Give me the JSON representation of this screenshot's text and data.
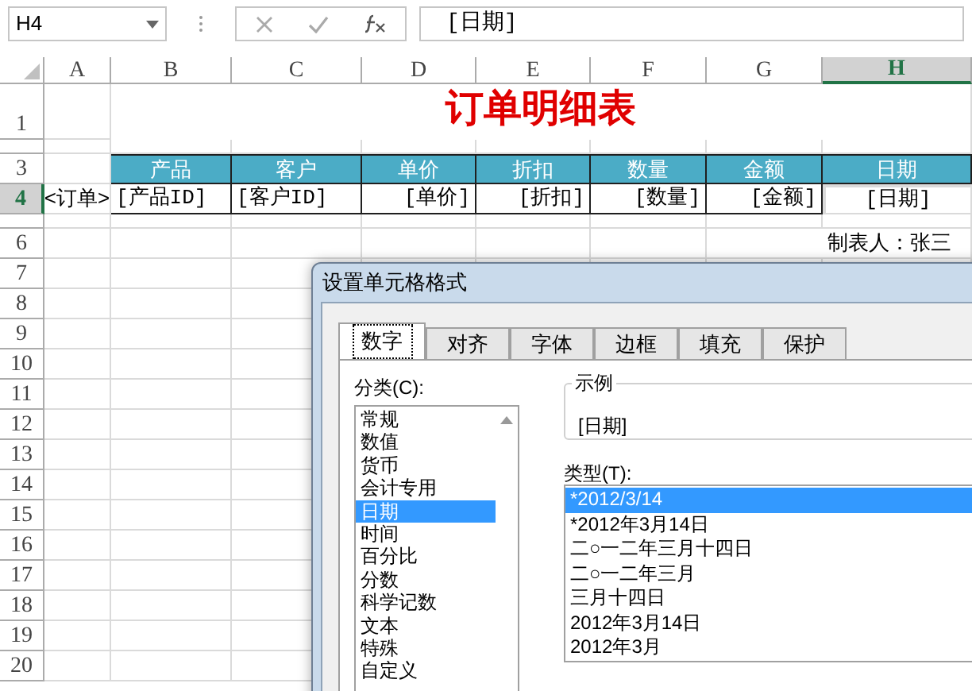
{
  "formula_bar": {
    "name_box": "H4",
    "formula": "[日期]"
  },
  "columns": [
    {
      "label": "A",
      "selected": false
    },
    {
      "label": "B",
      "selected": false
    },
    {
      "label": "C",
      "selected": false
    },
    {
      "label": "D",
      "selected": false
    },
    {
      "label": "E",
      "selected": false
    },
    {
      "label": "F",
      "selected": false
    },
    {
      "label": "G",
      "selected": false
    },
    {
      "label": "H",
      "selected": true
    }
  ],
  "rows": [
    {
      "kind": "title",
      "label": "1",
      "selected": false
    },
    {
      "kind": "short"
    },
    {
      "kind": "normal",
      "label": "3",
      "selected": false
    },
    {
      "kind": "normal",
      "label": "4",
      "selected": true
    },
    {
      "kind": "short"
    },
    {
      "kind": "normal",
      "label": "6",
      "selected": false
    },
    {
      "kind": "normal",
      "label": "7",
      "selected": false
    },
    {
      "kind": "normal",
      "label": "8",
      "selected": false
    },
    {
      "kind": "normal",
      "label": "9",
      "selected": false
    },
    {
      "kind": "normal",
      "label": "10",
      "selected": false
    },
    {
      "kind": "normal",
      "label": "11",
      "selected": false
    },
    {
      "kind": "normal",
      "label": "12",
      "selected": false
    },
    {
      "kind": "normal",
      "label": "13",
      "selected": false
    },
    {
      "kind": "normal",
      "label": "14",
      "selected": false
    },
    {
      "kind": "normal",
      "label": "15",
      "selected": false
    },
    {
      "kind": "normal",
      "label": "16",
      "selected": false
    },
    {
      "kind": "normal",
      "label": "17",
      "selected": false
    },
    {
      "kind": "normal",
      "label": "18",
      "selected": false
    },
    {
      "kind": "normal",
      "label": "19",
      "selected": false
    },
    {
      "kind": "normal",
      "label": "20",
      "selected": false
    }
  ],
  "sheet": {
    "title": "订单明细表",
    "marker": "<订单>",
    "headers": [
      "产品",
      "客户",
      "单价",
      "折扣",
      "数量",
      "金额",
      "日期"
    ],
    "fields": [
      {
        "text": "[产品ID]",
        "selected": false
      },
      {
        "text": "[客户ID]",
        "selected": false
      },
      {
        "text": "[单价]",
        "selected": false
      },
      {
        "text": "[折扣]",
        "selected": false
      },
      {
        "text": "[数量]",
        "selected": false
      },
      {
        "text": "[金额]",
        "selected": false
      },
      {
        "text": "[日期]",
        "selected": true
      }
    ],
    "signature": "制表人：张三"
  },
  "dialog": {
    "title": "设置单元格格式",
    "tabs": [
      {
        "label": "数字",
        "selected": true
      },
      {
        "label": "对齐",
        "selected": false
      },
      {
        "label": "字体",
        "selected": false
      },
      {
        "label": "边框",
        "selected": false
      },
      {
        "label": "填充",
        "selected": false
      },
      {
        "label": "保护",
        "selected": false
      }
    ],
    "category_label": "分类(C):",
    "categories": [
      {
        "label": "常规",
        "selected": false
      },
      {
        "label": "数值",
        "selected": false
      },
      {
        "label": "货币",
        "selected": false
      },
      {
        "label": "会计专用",
        "selected": false
      },
      {
        "label": "日期",
        "selected": true
      },
      {
        "label": "时间",
        "selected": false
      },
      {
        "label": "百分比",
        "selected": false
      },
      {
        "label": "分数",
        "selected": false
      },
      {
        "label": "科学记数",
        "selected": false
      },
      {
        "label": "文本",
        "selected": false
      },
      {
        "label": "特殊",
        "selected": false
      },
      {
        "label": "自定义",
        "selected": false
      }
    ],
    "sample_label": "示例",
    "sample_value": "[日期]",
    "type_label": "类型(T):",
    "types": [
      {
        "label": "*2012/3/14",
        "selected": true
      },
      {
        "label": "*2012年3月14日",
        "selected": false
      },
      {
        "label": "二○一二年三月十四日",
        "selected": false
      },
      {
        "label": "二○一二年三月",
        "selected": false
      },
      {
        "label": "三月十四日",
        "selected": false
      },
      {
        "label": "2012年3月14日",
        "selected": false
      },
      {
        "label": "2012年3月",
        "selected": false
      }
    ]
  }
}
